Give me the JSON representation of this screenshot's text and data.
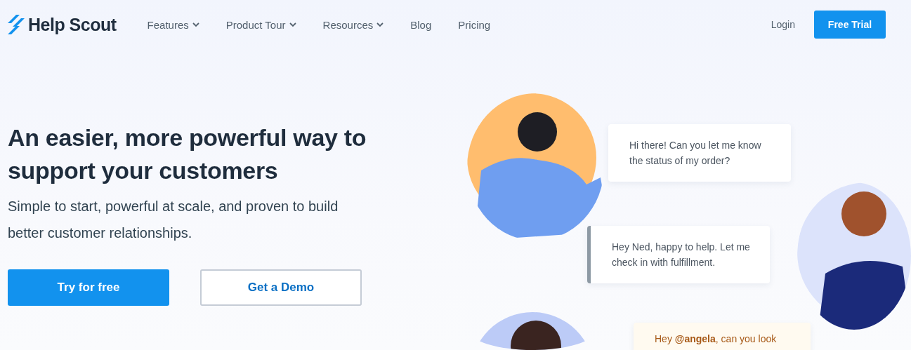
{
  "logo": {
    "text": "Help Scout"
  },
  "nav": [
    {
      "label": "Features",
      "dropdown": true
    },
    {
      "label": "Product Tour",
      "dropdown": true
    },
    {
      "label": "Resources",
      "dropdown": true
    },
    {
      "label": "Blog",
      "dropdown": false
    },
    {
      "label": "Pricing",
      "dropdown": false
    }
  ],
  "login": "Login",
  "cta": "Free Trial",
  "hero": {
    "title": "An easier, more powerful way to support your customers",
    "subtitle": "Simple to start, powerful at scale, and proven to build better customer relationships.",
    "buttons": [
      {
        "label": "Try for free",
        "kind": "primary"
      },
      {
        "label": "Get a Demo",
        "kind": "secondary"
      }
    ]
  },
  "conversation": [
    {
      "kind": "customer",
      "text": "Hi there! Can you let me know the status of my order?"
    },
    {
      "kind": "agent",
      "text": "Hey Ned, happy to help. Let me check in with fulfillment."
    },
    {
      "kind": "mention",
      "text": "Hey **@angela**, can you look"
    }
  ]
}
